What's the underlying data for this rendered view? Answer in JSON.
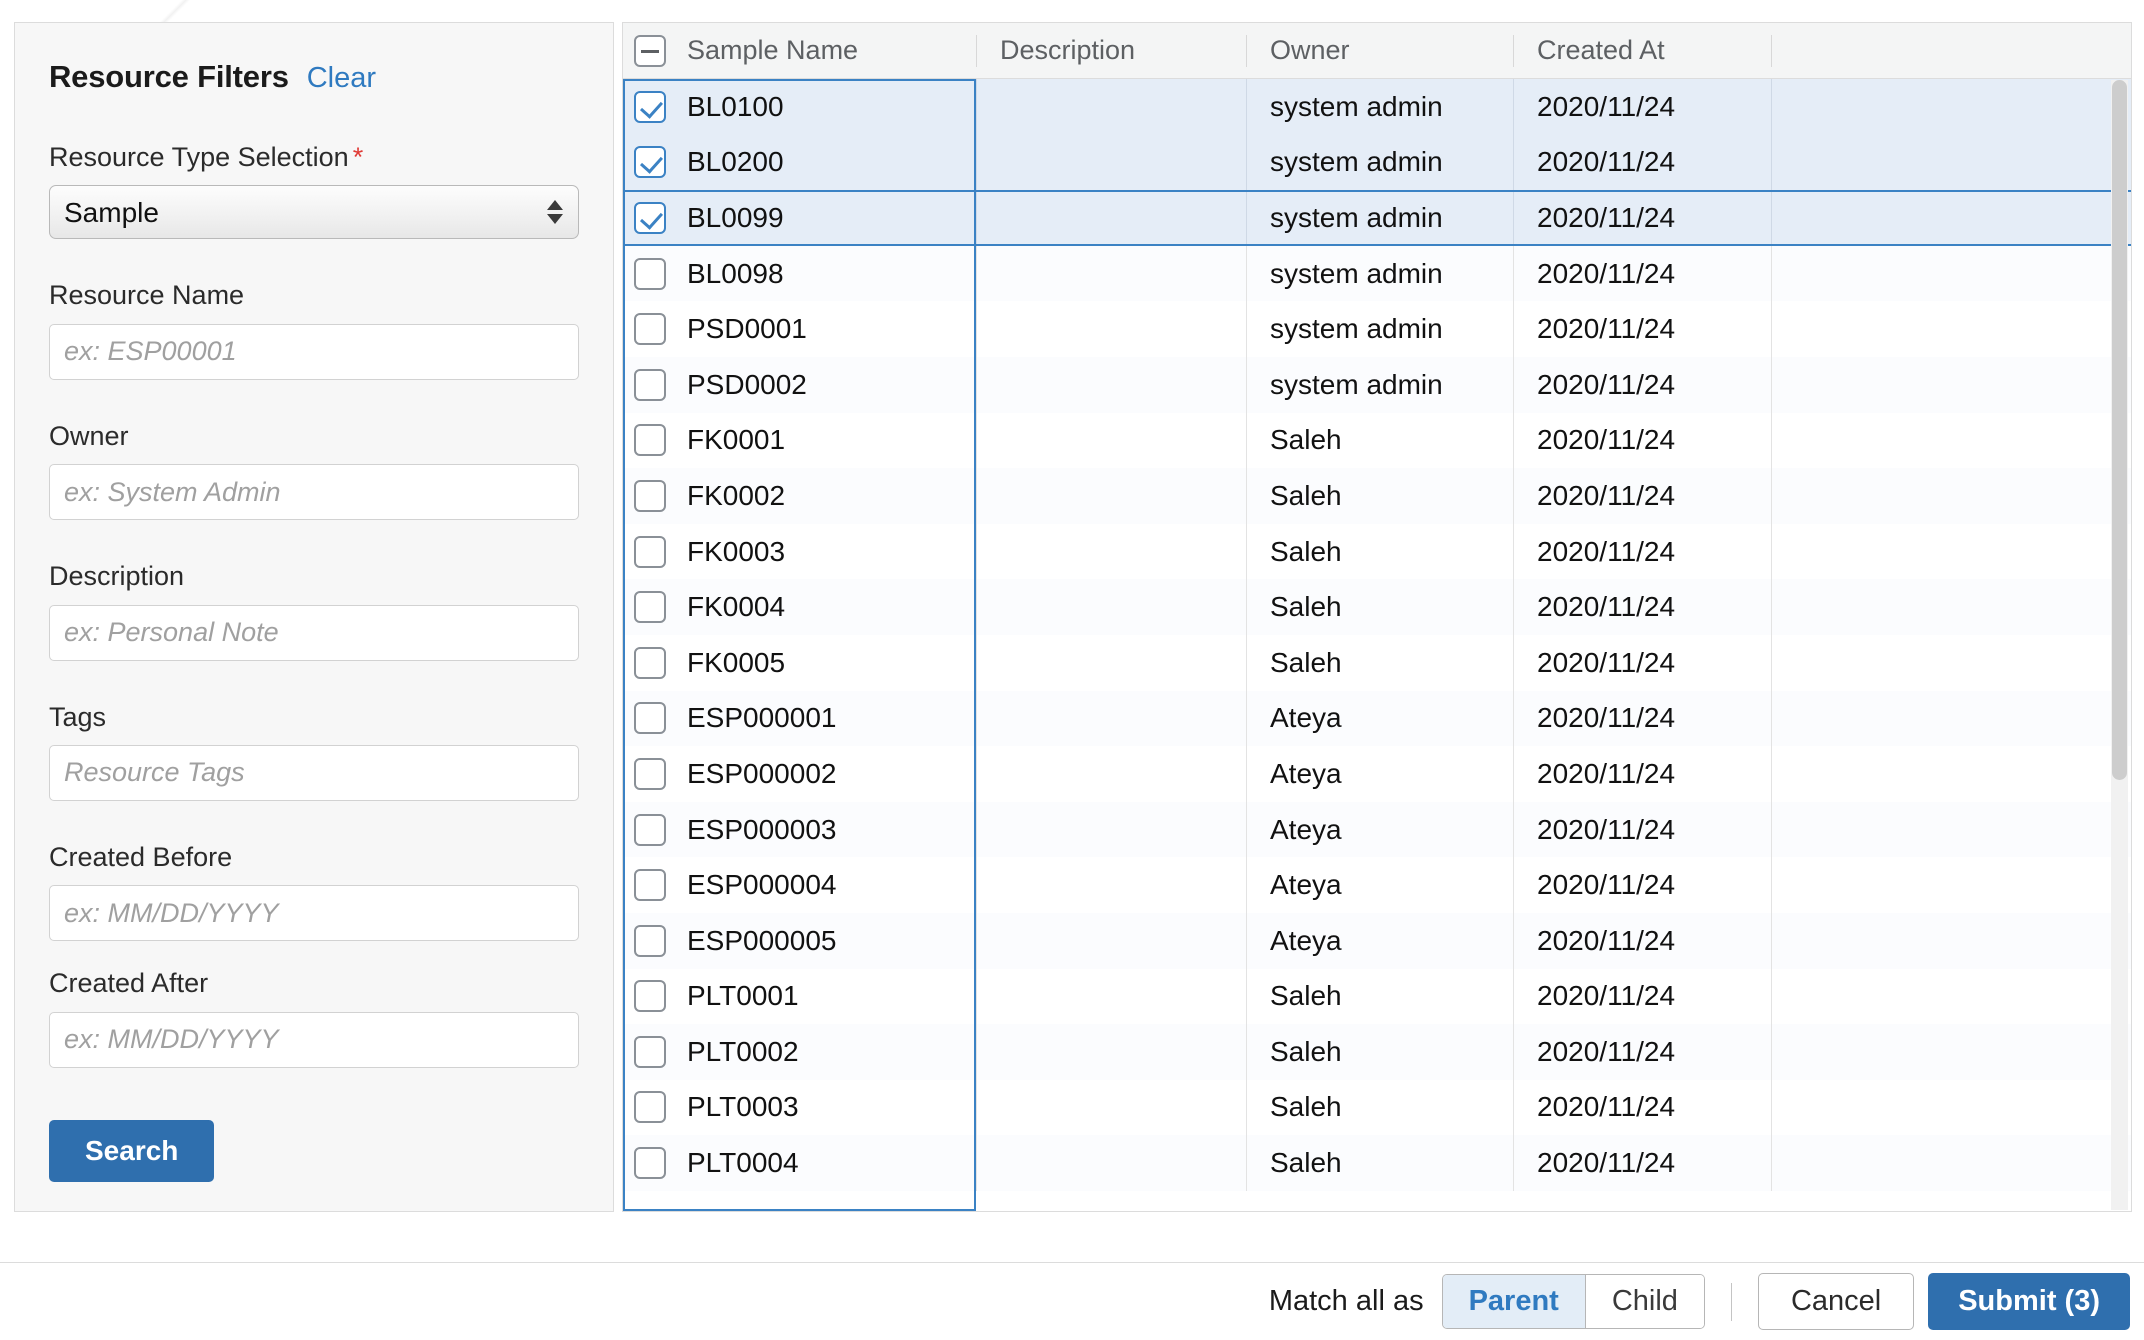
{
  "filter_panel": {
    "title": "Resource Filters",
    "clear_label": "Clear",
    "fields": {
      "resource_type": {
        "label": "Resource Type Selection",
        "required_marker": "*",
        "value": "Sample",
        "options": [
          "Sample"
        ]
      },
      "resource_name": {
        "label": "Resource Name",
        "value": "",
        "placeholder": "ex: ESP00001"
      },
      "owner": {
        "label": "Owner",
        "value": "",
        "placeholder": "ex: System Admin"
      },
      "description": {
        "label": "Description",
        "value": "",
        "placeholder": "ex: Personal Note"
      },
      "tags": {
        "label": "Tags",
        "value": "",
        "placeholder": "Resource Tags"
      },
      "created_before": {
        "label": "Created Before",
        "value": "",
        "placeholder": "ex: MM/DD/YYYY"
      },
      "created_after": {
        "label": "Created After",
        "value": "",
        "placeholder": "ex: MM/DD/YYYY"
      }
    },
    "search_label": "Search"
  },
  "table": {
    "header_checkbox_state": "indeterminate",
    "columns": [
      "Sample Name",
      "Description",
      "Owner",
      "Created At",
      ""
    ],
    "rows": [
      {
        "selected": true,
        "focused": false,
        "name": "BL0100",
        "description": "",
        "owner": "system admin",
        "created_at": "2020/11/24"
      },
      {
        "selected": true,
        "focused": false,
        "name": "BL0200",
        "description": "",
        "owner": "system admin",
        "created_at": "2020/11/24"
      },
      {
        "selected": true,
        "focused": true,
        "name": "BL0099",
        "description": "",
        "owner": "system admin",
        "created_at": "2020/11/24"
      },
      {
        "selected": false,
        "focused": false,
        "name": "BL0098",
        "description": "",
        "owner": "system admin",
        "created_at": "2020/11/24"
      },
      {
        "selected": false,
        "focused": false,
        "name": "PSD0001",
        "description": "",
        "owner": "system admin",
        "created_at": "2020/11/24"
      },
      {
        "selected": false,
        "focused": false,
        "name": "PSD0002",
        "description": "",
        "owner": "system admin",
        "created_at": "2020/11/24"
      },
      {
        "selected": false,
        "focused": false,
        "name": "FK0001",
        "description": "",
        "owner": "Saleh",
        "created_at": "2020/11/24"
      },
      {
        "selected": false,
        "focused": false,
        "name": "FK0002",
        "description": "",
        "owner": "Saleh",
        "created_at": "2020/11/24"
      },
      {
        "selected": false,
        "focused": false,
        "name": "FK0003",
        "description": "",
        "owner": "Saleh",
        "created_at": "2020/11/24"
      },
      {
        "selected": false,
        "focused": false,
        "name": "FK0004",
        "description": "",
        "owner": "Saleh",
        "created_at": "2020/11/24"
      },
      {
        "selected": false,
        "focused": false,
        "name": "FK0005",
        "description": "",
        "owner": "Saleh",
        "created_at": "2020/11/24"
      },
      {
        "selected": false,
        "focused": false,
        "name": "ESP000001",
        "description": "",
        "owner": "Ateya",
        "created_at": "2020/11/24"
      },
      {
        "selected": false,
        "focused": false,
        "name": "ESP000002",
        "description": "",
        "owner": "Ateya",
        "created_at": "2020/11/24"
      },
      {
        "selected": false,
        "focused": false,
        "name": "ESP000003",
        "description": "",
        "owner": "Ateya",
        "created_at": "2020/11/24"
      },
      {
        "selected": false,
        "focused": false,
        "name": "ESP000004",
        "description": "",
        "owner": "Ateya",
        "created_at": "2020/11/24"
      },
      {
        "selected": false,
        "focused": false,
        "name": "ESP000005",
        "description": "",
        "owner": "Ateya",
        "created_at": "2020/11/24"
      },
      {
        "selected": false,
        "focused": false,
        "name": "PLT0001",
        "description": "",
        "owner": "Saleh",
        "created_at": "2020/11/24"
      },
      {
        "selected": false,
        "focused": false,
        "name": "PLT0002",
        "description": "",
        "owner": "Saleh",
        "created_at": "2020/11/24"
      },
      {
        "selected": false,
        "focused": false,
        "name": "PLT0003",
        "description": "",
        "owner": "Saleh",
        "created_at": "2020/11/24"
      },
      {
        "selected": false,
        "focused": false,
        "name": "PLT0004",
        "description": "",
        "owner": "Saleh",
        "created_at": "2020/11/24"
      }
    ]
  },
  "footer": {
    "match_label": "Match all as",
    "match_options": [
      "Parent",
      "Child"
    ],
    "match_selected": "Parent",
    "cancel_label": "Cancel",
    "submit_label": "Submit (3)",
    "selected_count": 3
  },
  "colors": {
    "accent_blue": "#2f6fae",
    "link_blue": "#2f7ac0",
    "selected_row": "#e5edf7",
    "focus_border": "#3b82c4",
    "required_red": "#e03a35",
    "panel_bg": "#f7f7f7",
    "header_bg": "#f4f5f5"
  }
}
